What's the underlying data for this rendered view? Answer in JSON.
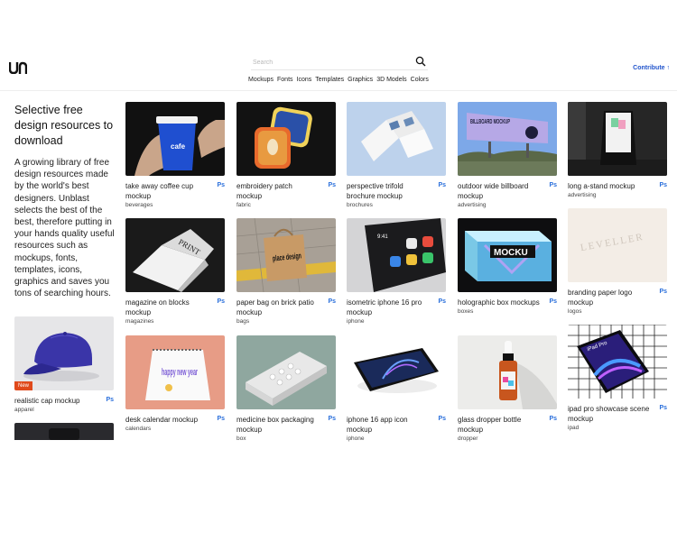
{
  "header": {
    "search_placeholder": "Search",
    "categories": [
      "Mockups",
      "Fonts",
      "Icons",
      "Templates",
      "Graphics",
      "3D Models",
      "Colors"
    ],
    "contribute_label": "Contribute ↑"
  },
  "intro": {
    "title": "Selective free design resources to download",
    "text": "A growing library of free design resources made by the world's best designers. Unblast selects the best of the best, therefore putting in your hands quality useful resources such as mockups, fonts, templates, icons, graphics and saves you tons of searching hours."
  },
  "cards": {
    "coffee": {
      "title": "take away coffee cup mockup",
      "category": "beverages",
      "badge": "Ps"
    },
    "patch": {
      "title": "embroidery patch mockup",
      "category": "fabric",
      "badge": "Ps"
    },
    "trifold": {
      "title": "perspective trifold brochure mockup",
      "category": "brochures",
      "badge": "Ps"
    },
    "billboard": {
      "title": "outdoor wide billboard mockup",
      "category": "advertising",
      "badge": "Ps"
    },
    "astand": {
      "title": "long a-stand mockup",
      "category": "advertising",
      "badge": "Ps"
    },
    "magazine": {
      "title": "magazine on blocks mockup",
      "category": "magazines",
      "badge": "Ps"
    },
    "paperbag": {
      "title": "paper bag on brick patio mockup",
      "category": "bags",
      "badge": "Ps"
    },
    "iphone16pro": {
      "title": "isometric iphone 16 pro mockup",
      "category": "iphone",
      "badge": "Ps"
    },
    "holobox": {
      "title": "holographic box mockups",
      "category": "boxes",
      "badge": "Ps"
    },
    "paperlogo": {
      "title": "branding paper logo mockup",
      "category": "logos",
      "badge": "Ps"
    },
    "cap": {
      "title": "realistic cap mockup",
      "category": "apparel",
      "badge": "Ps",
      "new_label": "New"
    },
    "calendar": {
      "title": "desk calendar mockup",
      "category": "calendars",
      "badge": "Ps"
    },
    "medicine": {
      "title": "medicine box packaging mockup",
      "category": "box",
      "badge": "Ps"
    },
    "iphoneapp": {
      "title": "iphone 16 app icon mockup",
      "category": "iphone",
      "badge": "Ps"
    },
    "dropper": {
      "title": "glass dropper bottle mockup",
      "category": "dropper",
      "badge": "Ps"
    },
    "ipad": {
      "title": "ipad pro showcase scene mockup",
      "category": "ipad",
      "badge": "Ps"
    }
  },
  "thumb_text": {
    "coffee_cup": "cafe",
    "billboard": "BILLBOARD MOCKUP",
    "magazine": "PRINT",
    "bag": "place design",
    "phone_time": "9:41",
    "holo": "MOCKU",
    "paper_logo": "LEVELLER",
    "calendar": "happy new year",
    "ipad": "iPad Pro"
  },
  "colors": {
    "accent": "#2255cc",
    "ps_badge": "#2a6fdb",
    "new_badge": "#e04a1c"
  }
}
